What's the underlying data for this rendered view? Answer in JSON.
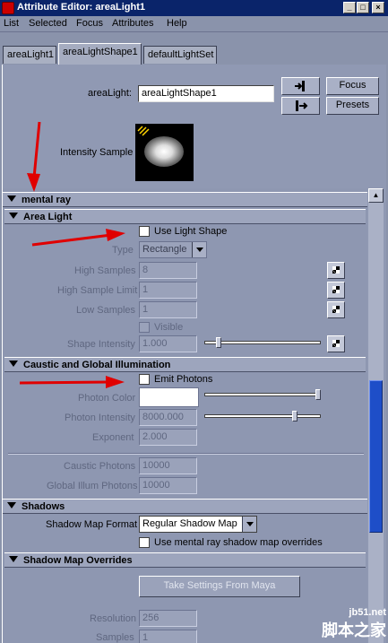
{
  "window": {
    "title": "Attribute Editor: areaLight1",
    "minimize": "_",
    "maximize": "□",
    "close": "×"
  },
  "menu": [
    "List",
    "Selected",
    "Focus",
    "Attributes",
    "Help"
  ],
  "tabs": [
    {
      "label": "areaLight1",
      "active": false
    },
    {
      "label": "areaLightShape1",
      "active": true
    },
    {
      "label": "defaultLightSet",
      "active": false
    }
  ],
  "header": {
    "node_label": "areaLight:",
    "node_value": "areaLightShape1",
    "focus_label": "Focus",
    "presets_label": "Presets",
    "intensity_sample_label": "Intensity Sample"
  },
  "mental_ray": {
    "label": "mental ray",
    "area_light": {
      "label": "Area Light",
      "use_light_shape_label": "Use Light Shape",
      "type_label": "Type",
      "type_value": "Rectangle",
      "high_samples_label": "High Samples",
      "high_samples_value": "8",
      "high_sample_limit_label": "High Sample Limit",
      "high_sample_limit_value": "1",
      "low_samples_label": "Low Samples",
      "low_samples_value": "1",
      "visible_label": "Visible",
      "shape_intensity_label": "Shape Intensity",
      "shape_intensity_value": "1.000"
    },
    "caustic_gi": {
      "label": "Caustic and Global Illumination",
      "emit_photons_label": "Emit Photons",
      "photon_color_label": "Photon Color",
      "photon_intensity_label": "Photon Intensity",
      "photon_intensity_value": "8000.000",
      "exponent_label": "Exponent",
      "exponent_value": "2.000",
      "caustic_photons_label": "Caustic Photons",
      "caustic_photons_value": "10000",
      "global_illum_photons_label": "Global Illum Photons",
      "global_illum_photons_value": "10000"
    }
  },
  "shadows": {
    "label": "Shadows",
    "shadow_map_format_label": "Shadow Map Format",
    "shadow_map_format_value": "Regular Shadow Map",
    "use_mr_overrides_label": "Use mental ray shadow map overrides"
  },
  "shadow_map_overrides": {
    "label": "Shadow Map Overrides",
    "take_settings_label": "Take Settings From Maya",
    "resolution_label": "Resolution",
    "resolution_value": "256",
    "samples_label": "Samples",
    "samples_value": "1"
  },
  "watermark": {
    "line1": "jb51.net",
    "line2": "脚本之家"
  },
  "colors": {
    "title_bar": "#0a246a",
    "panel": "#9099b3",
    "annotation_arrow": "#e00000",
    "scroll_thumb": "#1e4ec8"
  }
}
